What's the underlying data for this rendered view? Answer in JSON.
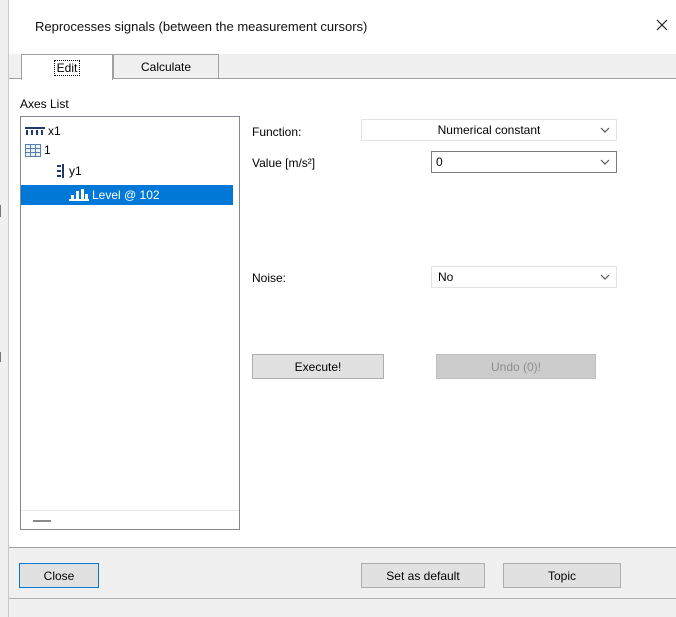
{
  "window": {
    "title": "Reprocesses signals (between the measurement cursors)",
    "close_icon": "close-icon"
  },
  "tabs": [
    {
      "label": "Edit",
      "active": true
    },
    {
      "label": "Calculate",
      "active": false
    }
  ],
  "axes_list": {
    "label": "Axes List",
    "items": [
      {
        "label": "x1",
        "icon": "x-axis-icon",
        "level": 0,
        "selected": false
      },
      {
        "label": "1",
        "icon": "table-icon",
        "level": 0,
        "selected": false
      },
      {
        "label": "y1",
        "icon": "y-axis-icon",
        "level": 1,
        "selected": false
      },
      {
        "label": "Level @ 102",
        "icon": "level-signal-icon",
        "level": 2,
        "selected": true
      }
    ]
  },
  "form": {
    "function_label": "Function:",
    "function_value": "Numerical constant",
    "value_label": "Value [m/s²]",
    "value_value": "0",
    "noise_label": "Noise:",
    "noise_value": "No"
  },
  "actions": {
    "execute_label": "Execute!",
    "undo_label": "Undo (0)!"
  },
  "footer": {
    "close_label": "Close",
    "set_default_label": "Set as default",
    "topic_label": "Topic"
  },
  "colors": {
    "selection": "#0078d7",
    "focus_border": "#0078d7"
  }
}
